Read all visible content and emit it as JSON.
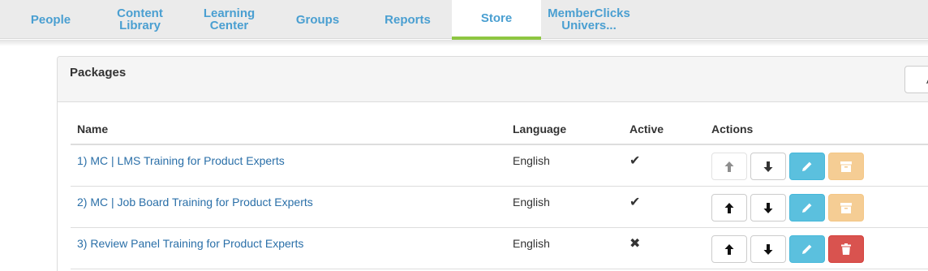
{
  "nav": {
    "tabs": [
      {
        "label": "People"
      },
      {
        "label": "Content\nLibrary"
      },
      {
        "label": "Learning\nCenter"
      },
      {
        "label": "Groups"
      },
      {
        "label": "Reports"
      },
      {
        "label": "Store",
        "active": true
      },
      {
        "label": "MemberClicks\nUnivers..."
      }
    ]
  },
  "panel": {
    "title": "Packages",
    "add_label": "Ad"
  },
  "table": {
    "columns": {
      "name": "Name",
      "language": "Language",
      "active": "Active",
      "actions": "Actions"
    },
    "rows": [
      {
        "name": "1) MC | LMS Training for Product Experts",
        "language": "English",
        "active": "✔",
        "up_enabled": false,
        "last_action": "archive"
      },
      {
        "name": "2) MC | Job Board Training for Product Experts",
        "language": "English",
        "active": "✔",
        "up_enabled": true,
        "last_action": "archive"
      },
      {
        "name": "3) Review Panel Training for Product Experts",
        "language": "English",
        "active": "✖",
        "up_enabled": true,
        "last_action": "delete"
      }
    ]
  },
  "colors": {
    "nav_text": "#4a9fd1",
    "active_underline": "#8ec641",
    "link": "#2a6fa8",
    "edit_btn": "#5bc0de",
    "archive_btn": "#f0ad4e",
    "delete_btn": "#d9534f"
  }
}
